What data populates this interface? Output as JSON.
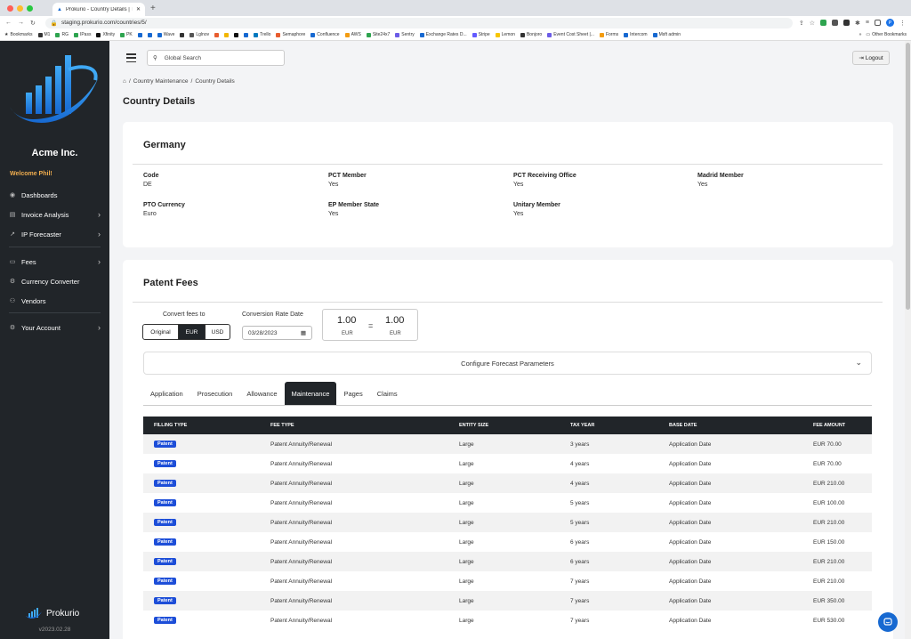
{
  "browser": {
    "tab_title": "Prokurio - Country Details | Th",
    "url": "staging.prokurio.com/countries/5/",
    "profile_initial": "P",
    "bookmarks": [
      "Bookmarks",
      "M1",
      "RG",
      "IPass",
      "Xfinity",
      "PK",
      "Wave",
      "Lglnov",
      "Trello",
      "Semaphore",
      "Confluence",
      "AWS",
      "Site24x7",
      "Sentry",
      "Exchange Rates D...",
      "Stripe",
      "Lemon",
      "Bonjoro",
      "Event Cost Sheet |...",
      "Forms",
      "Intercom",
      "Msft admin"
    ],
    "bookmarks_more": "»",
    "other_bookmarks": "Other Bookmarks"
  },
  "sidebar": {
    "company": "Acme Inc.",
    "welcome": "Welcome Phil!",
    "items": [
      {
        "label": "Dashboards"
      },
      {
        "label": "Invoice Analysis"
      },
      {
        "label": "IP Forecaster"
      },
      {
        "label": "Fees"
      },
      {
        "label": "Currency Converter"
      },
      {
        "label": "Vendors"
      },
      {
        "label": "Your Account"
      }
    ],
    "brand": "Prokurio",
    "version": "v2023.02.28"
  },
  "header": {
    "search_placeholder": "Global Search",
    "logout": "Logout"
  },
  "breadcrumb": [
    "Country Maintenance",
    "Country Details"
  ],
  "breadcrumb_sep": "/",
  "page_title": "Country Details",
  "country": {
    "name": "Germany",
    "fields": [
      {
        "label": "Code",
        "value": "DE"
      },
      {
        "label": "PCT Member",
        "value": "Yes"
      },
      {
        "label": "PCT Receiving Office",
        "value": "Yes"
      },
      {
        "label": "Madrid Member",
        "value": "Yes"
      },
      {
        "label": "PTO Currency",
        "value": "Euro"
      },
      {
        "label": "EP Member State",
        "value": "Yes"
      },
      {
        "label": "Unitary Member",
        "value": "Yes"
      }
    ]
  },
  "fees": {
    "title": "Patent Fees",
    "convert_label": "Convert fees to",
    "currency_options": [
      "Original",
      "EUR",
      "USD"
    ],
    "selected_currency": "EUR",
    "rate_date_label": "Conversion Rate Date",
    "rate_date": "03/28/2023",
    "rate_from_value": "1.00",
    "rate_from_currency": "EUR",
    "rate_to_value": "1.00",
    "rate_to_currency": "EUR",
    "rate_eq": "=",
    "forecast_label": "Configure Forecast Parameters",
    "tabs": [
      "Application",
      "Prosecution",
      "Allowance",
      "Maintenance",
      "Pages",
      "Claims"
    ],
    "active_tab": "Maintenance",
    "columns": [
      "FILLING TYPE",
      "FEE TYPE",
      "ENTITY SIZE",
      "TAX YEAR",
      "BASE DATE",
      "FEE AMOUNT"
    ],
    "rows": [
      [
        "Patent",
        "Patent Annuity/Renewal",
        "Large",
        "3 years",
        "Application Date",
        "EUR 70.00"
      ],
      [
        "Patent",
        "Patent Annuity/Renewal",
        "Large",
        "4 years",
        "Application Date",
        "EUR 70.00"
      ],
      [
        "Patent",
        "Patent Annuity/Renewal",
        "Large",
        "4 years",
        "Application Date",
        "EUR 210.00"
      ],
      [
        "Patent",
        "Patent Annuity/Renewal",
        "Large",
        "5 years",
        "Application Date",
        "EUR 100.00"
      ],
      [
        "Patent",
        "Patent Annuity/Renewal",
        "Large",
        "5 years",
        "Application Date",
        "EUR 210.00"
      ],
      [
        "Patent",
        "Patent Annuity/Renewal",
        "Large",
        "6 years",
        "Application Date",
        "EUR 150.00"
      ],
      [
        "Patent",
        "Patent Annuity/Renewal",
        "Large",
        "6 years",
        "Application Date",
        "EUR 210.00"
      ],
      [
        "Patent",
        "Patent Annuity/Renewal",
        "Large",
        "7 years",
        "Application Date",
        "EUR 210.00"
      ],
      [
        "Patent",
        "Patent Annuity/Renewal",
        "Large",
        "7 years",
        "Application Date",
        "EUR 350.00"
      ],
      [
        "Patent",
        "Patent Annuity/Renewal",
        "Large",
        "7 years",
        "Application Date",
        "EUR 530.00"
      ]
    ]
  },
  "colors": {
    "sidebar_bg": "#212529",
    "accent": "#1d4ed8",
    "welcome": "#f0ad4e"
  }
}
